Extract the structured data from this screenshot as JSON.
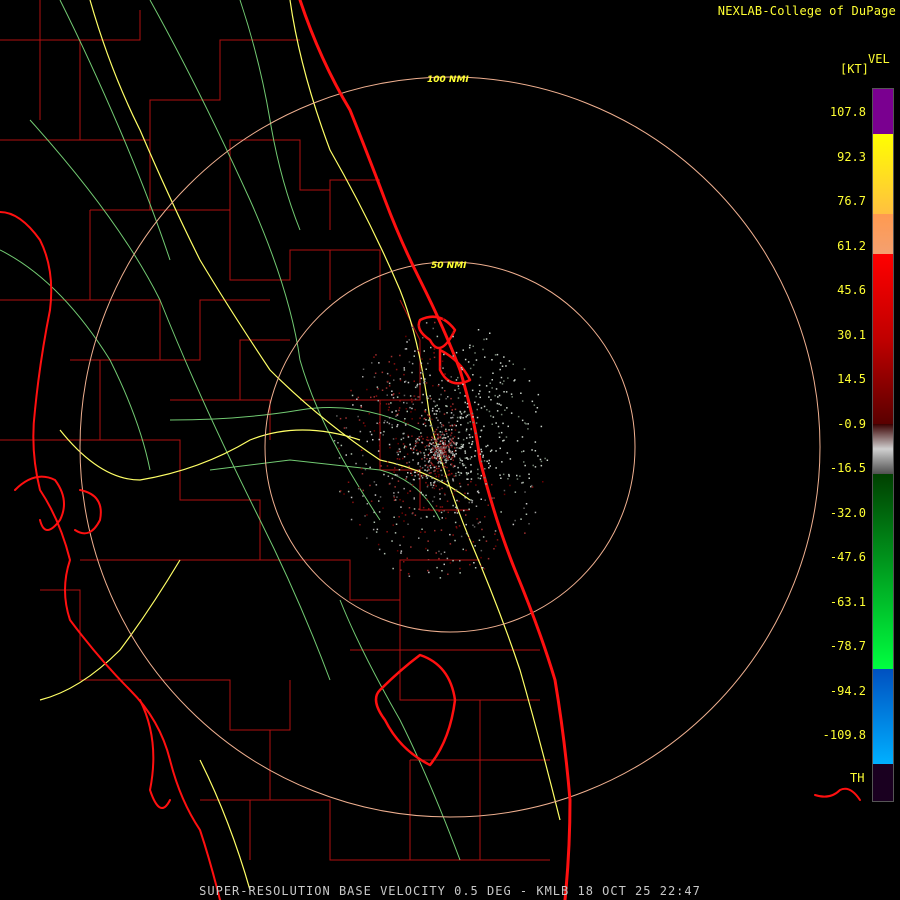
{
  "credit": "NEXLAB-College of DuPage",
  "caption": "SUPER-RESOLUTION BASE VELOCITY 0.5 DEG - KMLB 18 OCT 25 22:47",
  "legend": {
    "unit": "[KT]",
    "product": "VEL",
    "th_label": "TH",
    "ticks": [
      "107.8",
      "92.3",
      "76.7",
      "61.2",
      "45.6",
      "30.1",
      "14.5",
      "-0.9",
      "-16.5",
      "-32.0",
      "-47.6",
      "-63.1",
      "-78.7",
      "-94.2",
      "-109.8"
    ],
    "colors": {
      "purple": "#7a0090",
      "yellow": "#ffff00",
      "peach": "#f4a070",
      "red": "#ff0000",
      "darkred": "#5a0000",
      "gray": "#d0d0d0",
      "darkgreen": "#004000",
      "green": "#00ff40",
      "blue": "#0060ff",
      "cyan": "#00b0ff"
    }
  },
  "rings": {
    "inner_label": "50 NMI",
    "outer_label": "100 NMI",
    "color": "#f0b090"
  },
  "map_colors": {
    "coast": "#ff1010",
    "county": "#c01010",
    "highway": "#ffff66",
    "road": "#88ee88"
  },
  "radar_site": "KMLB"
}
